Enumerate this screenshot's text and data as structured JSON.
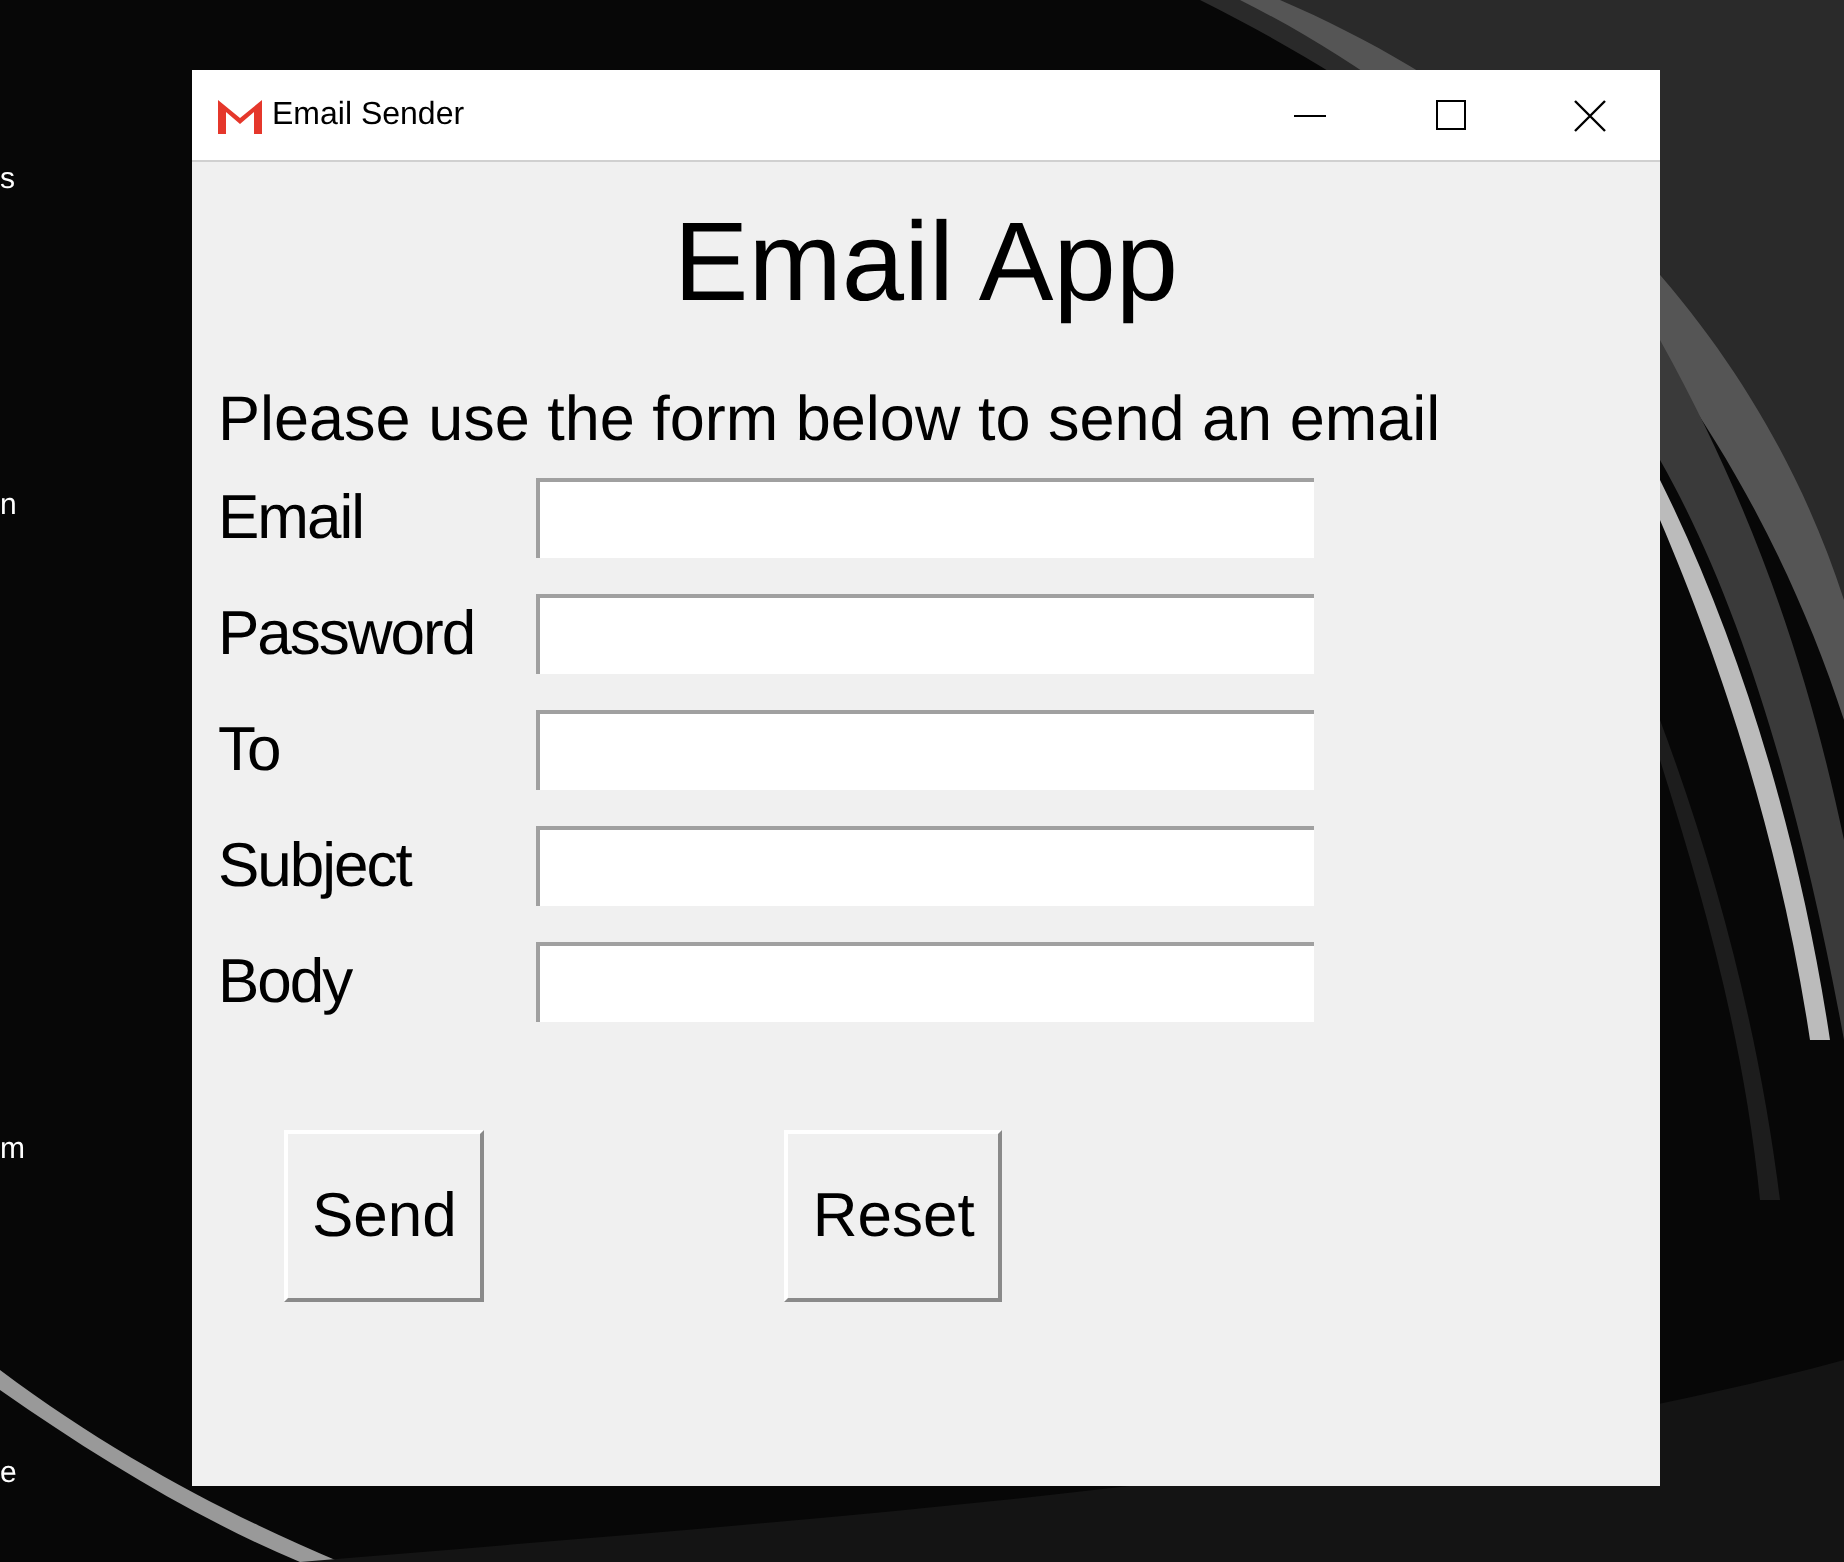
{
  "desktop_labels": [
    "s",
    "n",
    "m",
    "e"
  ],
  "window": {
    "title": "Email Sender"
  },
  "heading": "Email App",
  "instructions": "Please use the form below to send an email",
  "fields": [
    {
      "label": "Email"
    },
    {
      "label": "Password"
    },
    {
      "label": "To"
    },
    {
      "label": "Subject"
    },
    {
      "label": "Body"
    }
  ],
  "buttons": [
    "Send",
    "Reset"
  ]
}
